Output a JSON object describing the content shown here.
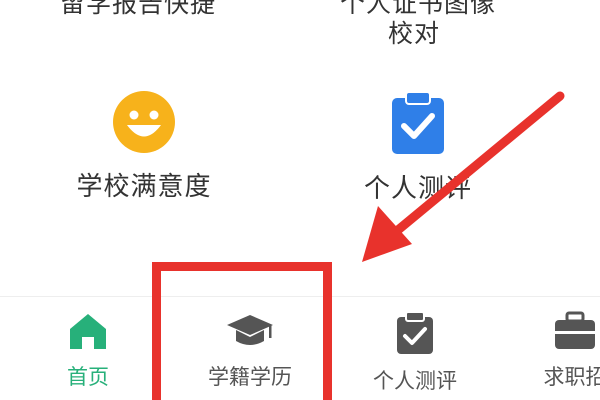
{
  "top_partial": {
    "left_label": "留学报告快捷",
    "right_label_line1": "个人证书图像",
    "right_label_line2": "校对"
  },
  "grid": {
    "satisfaction": {
      "label": "学校满意度",
      "icon": "smiley-face-icon"
    },
    "evaluation": {
      "label": "个人测评",
      "icon": "clipboard-check-icon"
    }
  },
  "tabbar": {
    "items": [
      {
        "label": "首页",
        "icon": "home-icon",
        "active": true
      },
      {
        "label": "学籍学历",
        "icon": "graduation-cap-icon",
        "active": false
      },
      {
        "label": "个人测评",
        "icon": "clipboard-check-icon",
        "active": false
      },
      {
        "label": "求职招",
        "icon": "briefcase-icon",
        "active": false
      }
    ]
  },
  "colors": {
    "accent_green": "#27b07a",
    "smiley_yellow": "#f7b21b",
    "clipboard_blue": "#2f7fe8",
    "annotation_red": "#e8322c",
    "tab_icon_gray": "#555555"
  }
}
